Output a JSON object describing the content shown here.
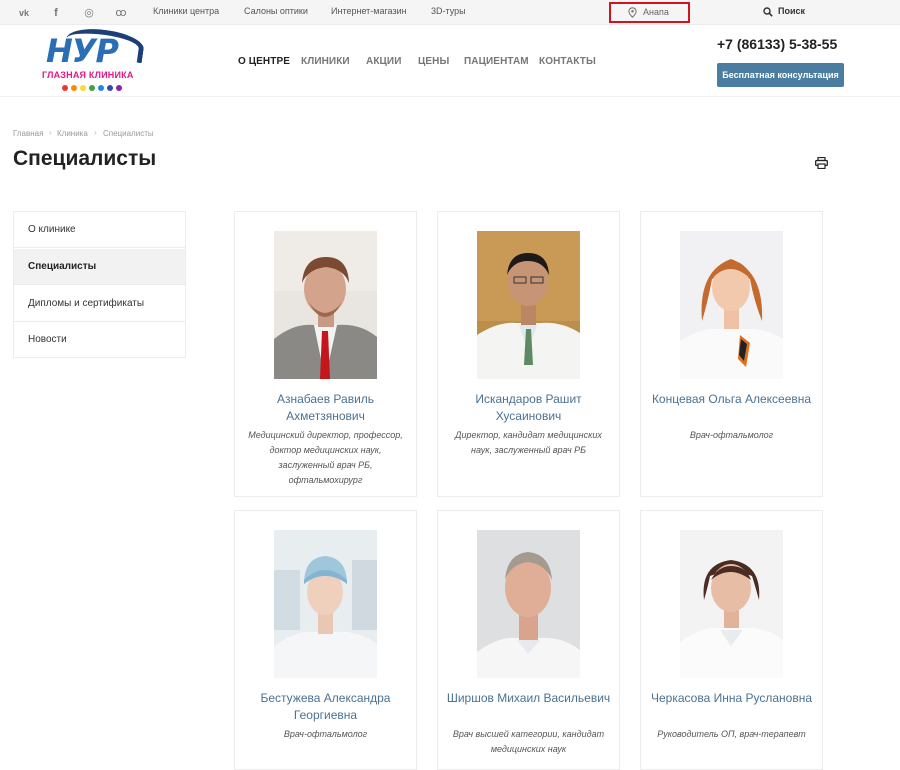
{
  "topbar": {
    "social": [
      {
        "icon": "vk-icon",
        "glyph": "vk"
      },
      {
        "icon": "facebook-icon",
        "glyph": "f"
      },
      {
        "icon": "instagram-icon",
        "glyph": "◎"
      },
      {
        "icon": "odnoklassniki-icon",
        "glyph": "ꝏ"
      }
    ],
    "links": [
      "Клиники центра",
      "Салоны оптики",
      "Интернет-магазин",
      "3D-туры"
    ],
    "city": "Анапа",
    "search_label": "Поиск"
  },
  "header": {
    "logo_brand": "НУР",
    "logo_sub": "ГЛАЗНАЯ КЛИНИКА",
    "logo_dot_colors": [
      "#e53935",
      "#fb8c00",
      "#fdd835",
      "#43a047",
      "#1e88e5",
      "#3949ab",
      "#8e24aa"
    ],
    "nav": [
      "О ЦЕНТРЕ",
      "КЛИНИКИ",
      "АКЦИИ",
      "ЦЕНЫ",
      "ПАЦИЕНТАМ",
      "КОНТАКТЫ"
    ],
    "phone": "+7 (86133) 5-38-55",
    "consult_button": "Бесплатная консультация",
    "accent_color": "#4b7da0"
  },
  "breadcrumb": [
    "Главная",
    "Клиника",
    "Специалисты"
  ],
  "page_title": "Специалисты",
  "sidebar": {
    "items": [
      "О клинике",
      "Специалисты",
      "Дипломы и сертификаты",
      "Новости"
    ],
    "active_index": 1
  },
  "specialists": [
    {
      "name": "Азнабаев Равиль Ахметзянович",
      "position": "Медицинский директор, профессор, доктор медицинских наук, заслуженный врач РБ, офтальмохирург"
    },
    {
      "name": "Искандаров Рашит Хусаинович",
      "position": "Директор, кандидат медицинских наук, заслуженный врач РБ"
    },
    {
      "name": "Концевая Ольга Алексеевна",
      "position": "Врач-офтальмолог"
    },
    {
      "name": "Бестужева Александра Георгиевна",
      "position": "Врач-офтальмолог"
    },
    {
      "name": "Ширшов Михаил Васильевич",
      "position": "Врач высшей категории, кандидат медицинских наук"
    },
    {
      "name": "Черкасова Инна Руслановна",
      "position": "Руководитель ОП, врач-терапевт"
    }
  ]
}
